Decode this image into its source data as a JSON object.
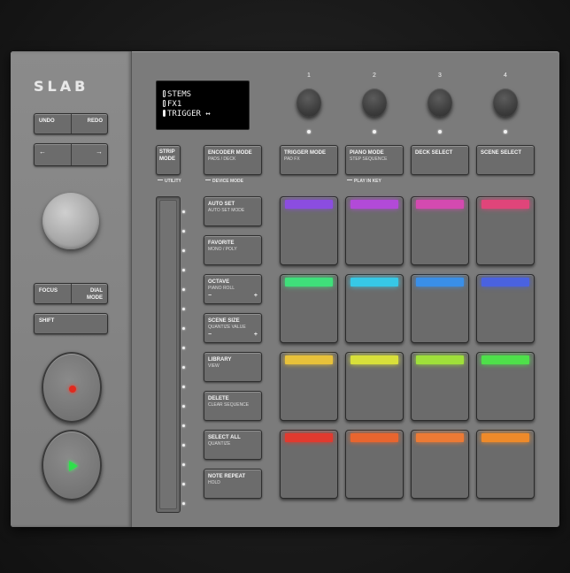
{
  "brand": {
    "logo": "SLAB"
  },
  "left": {
    "undo": "UNDO",
    "redo": "REDO",
    "left_arrow": "←",
    "right_arrow": "→",
    "focus": "FOCUS",
    "dial_mode": "DIAL MODE",
    "shift": "SHIFT"
  },
  "display": {
    "lines": [
      "STEMS",
      "FX1",
      "TRIGGER ↔"
    ]
  },
  "knobs": [
    "1",
    "2",
    "3",
    "4"
  ],
  "strip_mode": {
    "line1": "STRIP",
    "line2": "MODE",
    "sublabel": "UTILITY"
  },
  "top_buttons": [
    {
      "title": "ENCODER MODE",
      "sub": "PADS / DECK"
    },
    {
      "title": "TRIGGER MODE",
      "sub": "PAD FX"
    },
    {
      "title": "PIANO MODE",
      "sub": "STEP SEQUENCE"
    },
    {
      "title": "DECK SELECT",
      "sub": ""
    },
    {
      "title": "SCENE SELECT",
      "sub": ""
    }
  ],
  "group_labels": {
    "device_mode": "DEVICE MODE",
    "play_in_key": "PLAY IN KEY"
  },
  "side_buttons": [
    {
      "title": "AUTO SET",
      "sub": "AUTO SET MODE",
      "minus": "",
      "plus": ""
    },
    {
      "title": "FAVORITE",
      "sub": "MONO / POLY",
      "minus": "",
      "plus": ""
    },
    {
      "title": "OCTAVE",
      "sub": "PIANO ROLL",
      "minus": "−",
      "plus": "+"
    },
    {
      "title": "SCENE SIZE",
      "sub": "QUANTIZE VALUE",
      "minus": "−",
      "plus": "+"
    },
    {
      "title": "LIBRARY",
      "sub": "VIEW",
      "minus": "",
      "plus": ""
    },
    {
      "title": "DELETE",
      "sub": "CLEAR SEQUENCE",
      "minus": "",
      "plus": ""
    },
    {
      "title": "SELECT ALL",
      "sub": "QUANTIZE",
      "minus": "",
      "plus": ""
    },
    {
      "title": "NOTE REPEAT",
      "sub": "HOLD",
      "minus": "",
      "plus": ""
    }
  ],
  "pads": [
    [
      "#8b4de0",
      "#b24ad8",
      "#d44ab0",
      "#e0457a"
    ],
    [
      "#3fe07a",
      "#37c8e6",
      "#3a8fe8",
      "#4a62e0"
    ],
    [
      "#e8c23a",
      "#d8e03a",
      "#9fe03a",
      "#4ee04a"
    ],
    [
      "#e03a2f",
      "#e8652f",
      "#ec7a35",
      "#ee8a2a"
    ]
  ]
}
